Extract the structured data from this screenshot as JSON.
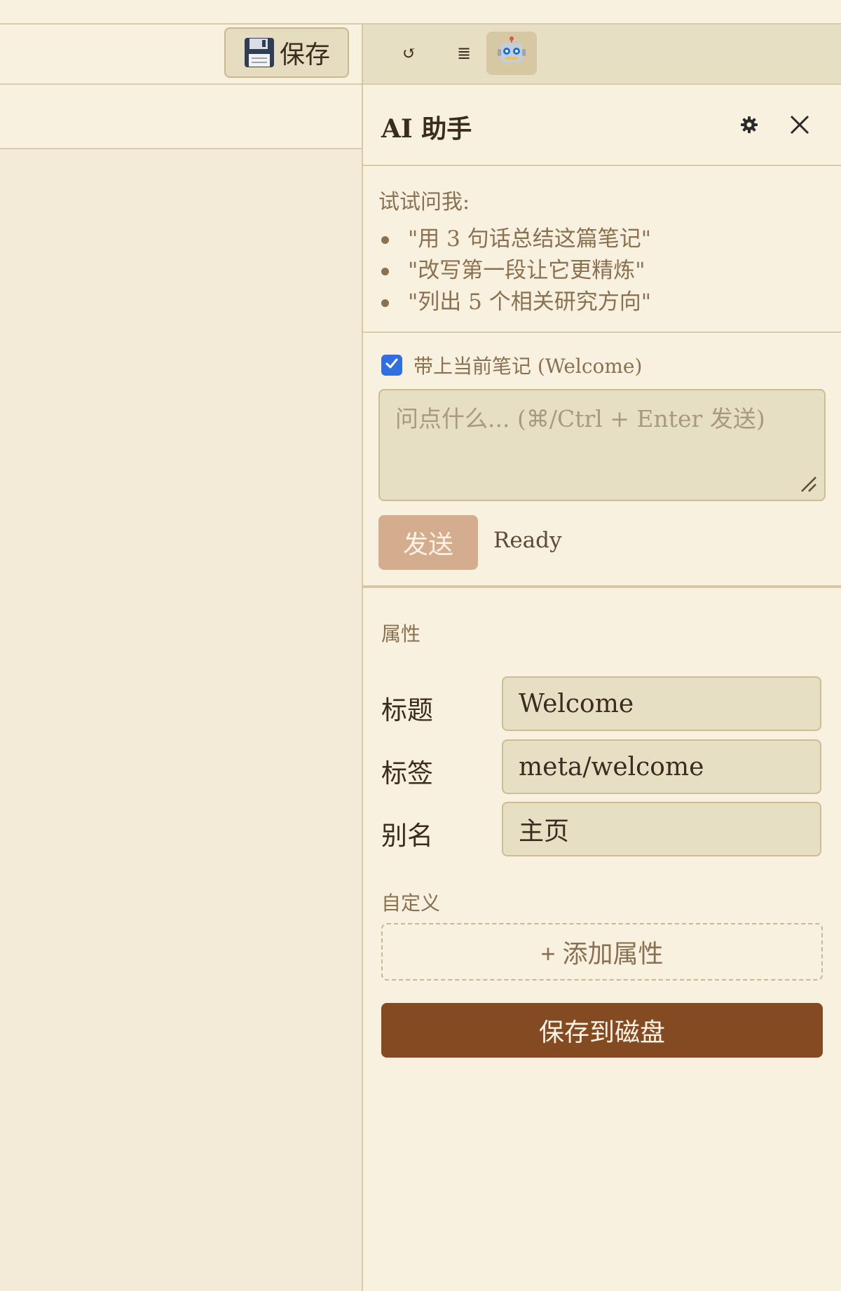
{
  "toolbar": {
    "save_label": "保存",
    "save_icon": "floppy-disk-icon",
    "refresh_glyph": "↺",
    "list_glyph": "≣",
    "assistant_icon": "robot-icon"
  },
  "ai_panel": {
    "title": "AI 助手",
    "settings_icon": "gear-icon",
    "close_icon": "close-icon",
    "suggestions_heading": "试试问我:",
    "suggestions": [
      "\"用 3 句话总结这篇笔记\"",
      "\"改写第一段让它更精炼\"",
      "\"列出 5 个相关研究方向\""
    ],
    "include_note_label": "带上当前笔记 (Welcome)",
    "include_note_checked": true,
    "input_placeholder": "问点什么... (⌘/Ctrl + Enter 发送)",
    "input_value": "",
    "send_label": "发送",
    "status": "Ready"
  },
  "properties": {
    "heading": "属性",
    "fields": [
      {
        "label": "标题",
        "value": "Welcome"
      },
      {
        "label": "标签",
        "value": "meta/welcome"
      },
      {
        "label": "别名",
        "value": "主页"
      }
    ],
    "custom_heading": "自定义",
    "add_label": "+ 添加属性",
    "save_to_disk_label": "保存到磁盘"
  },
  "colors": {
    "background": "#f9f1e0",
    "toolbar": "#e6dfc3",
    "accent_brown": "#844a22",
    "send_button": "#d3ad8e",
    "checkbox_blue": "#2f6fdf",
    "muted_text": "#8a7150"
  }
}
